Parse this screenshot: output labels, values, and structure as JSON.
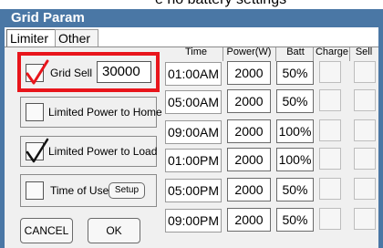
{
  "background_text": "e no battery settings",
  "window": {
    "title": "Grid Param"
  },
  "tabs": [
    {
      "label": "Limiter",
      "active": true
    },
    {
      "label": "Other",
      "active": false
    }
  ],
  "left": {
    "grid_sell": {
      "label": "Grid Sell",
      "checked": true,
      "value": "30000"
    },
    "limited_power_to_home": {
      "label": "Limited Power to Home",
      "checked": false
    },
    "limited_power_to_load": {
      "label": "Limited Power to Load",
      "checked": true
    },
    "time_of_use": {
      "label": "Time of Use",
      "checked": false,
      "setup_label": "Setup"
    },
    "cancel_label": "CANCEL",
    "ok_label": "OK"
  },
  "table": {
    "headers": {
      "time": "Time",
      "power": "Power(W)",
      "batt": "Batt",
      "charge": "Charge",
      "sell": "Sell"
    },
    "rows": [
      {
        "time": "01:00AM",
        "power": "2000",
        "batt": "50%"
      },
      {
        "time": "05:00AM",
        "power": "2000",
        "batt": "50%"
      },
      {
        "time": "09:00AM",
        "power": "2000",
        "batt": "100%"
      },
      {
        "time": "01:00PM",
        "power": "2000",
        "batt": "100%"
      },
      {
        "time": "05:00PM",
        "power": "2000",
        "batt": "50%"
      },
      {
        "time": "09:00PM",
        "power": "2000",
        "batt": "50%"
      }
    ]
  },
  "colors": {
    "titlebar": "#4a77a5",
    "highlight": "#e8151b",
    "check_red": "#e8151b",
    "check_black": "#111111"
  }
}
